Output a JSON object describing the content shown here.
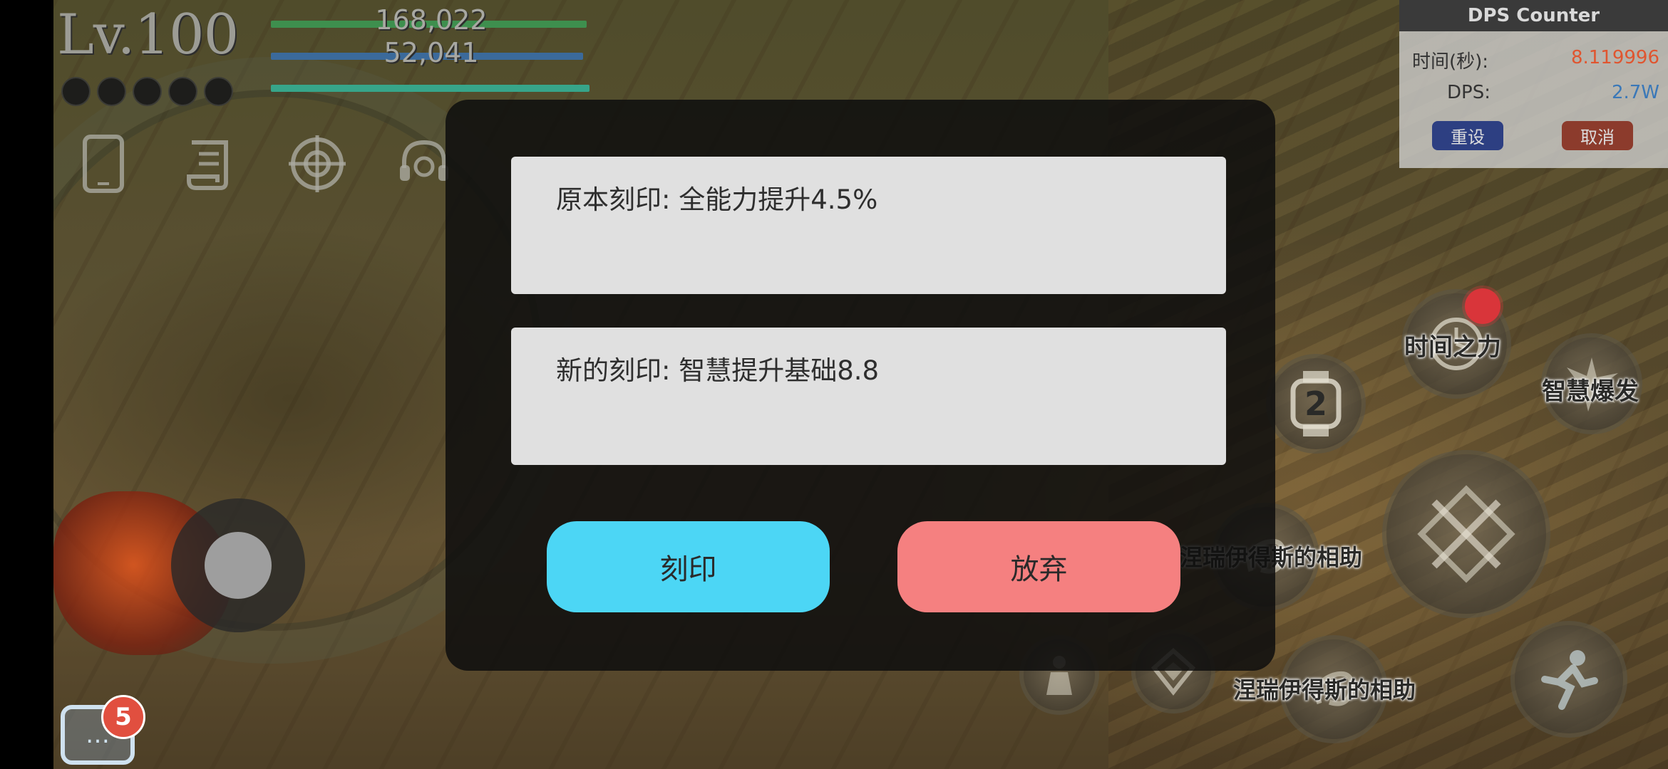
{
  "hud": {
    "level": "Lv.100",
    "hp_value": "168,022",
    "mp_value": "52,041",
    "pip_count": 5,
    "hp_color": "#3e8f4e",
    "mp_color": "#3b6a9b",
    "xp_color": "#37a58a",
    "icons": [
      "phone-icon",
      "scroll-icon",
      "target-icon",
      "headset-icon"
    ]
  },
  "dps_counter": {
    "title": "DPS Counter",
    "time_label": "时间(秒):",
    "time_value": "8.119996",
    "dps_label": "DPS:",
    "dps_value": "2.7W",
    "reset_label": "重设",
    "cancel_label": "取消"
  },
  "modal": {
    "original_inscription": "原本刻印: 全能力提升4.5%",
    "new_inscription": "新的刻印: 智慧提升基础8.8",
    "engrave_label": "刻印",
    "abandon_label": "放弃",
    "engrave_color": "#4cd6f5",
    "abandon_color": "#f58080"
  },
  "skills": {
    "time_power": "时间之力",
    "wisdom_burst": "智慧爆发",
    "aid_1": "涅瑞伊得斯的相助",
    "aid_2": "涅瑞伊得斯的相助",
    "watch_number": "2"
  },
  "chat": {
    "unread_count": "5"
  }
}
